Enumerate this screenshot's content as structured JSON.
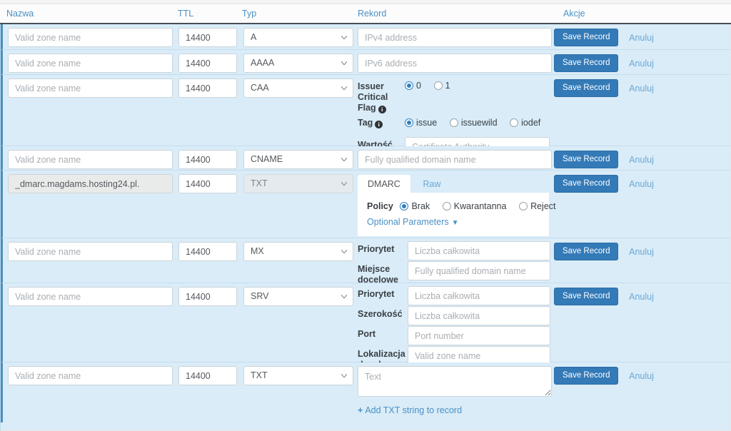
{
  "table": {
    "headers": {
      "name": "Nazwa",
      "ttl": "TTL",
      "type": "Typ",
      "record": "Rekord",
      "actions": "Akcje"
    },
    "common": {
      "name_placeholder": "Valid zone name",
      "ttl_value": "14400",
      "save_label": "Save Record",
      "cancel_label": "Anuluj"
    },
    "rows": [
      {
        "id": "a-record",
        "type_value": "A",
        "name_placeholder": "Valid zone name",
        "name_value": "",
        "ttl_value": "14400",
        "record_placeholder": "IPv4 address"
      },
      {
        "id": "aaaa-record",
        "type_value": "AAAA",
        "name_placeholder": "Valid zone name",
        "name_value": "",
        "ttl_value": "14400",
        "record_placeholder": "IPv6 address"
      },
      {
        "id": "caa-record",
        "type_value": "CAA",
        "name_placeholder": "Valid zone name",
        "name_value": "",
        "ttl_value": "14400",
        "issuer_flag_label": "Issuer Critical Flag",
        "issuer_flag_options": [
          "0",
          "1"
        ],
        "issuer_flag_selected": "0",
        "tag_label": "Tag",
        "tag_options": [
          "issue",
          "issuewild",
          "iodef"
        ],
        "tag_selected": "issue",
        "value_label": "Wartość",
        "value_placeholder": "Certificate Authority"
      },
      {
        "id": "cname-record",
        "type_value": "CNAME",
        "name_placeholder": "Valid zone name",
        "name_value": "",
        "ttl_value": "14400",
        "record_placeholder": "Fully qualified domain name"
      },
      {
        "id": "dmarc-record",
        "type_value": "TXT",
        "name_value": "_dmarc.magdams.hosting24.pl.",
        "name_disabled": true,
        "type_disabled": true,
        "ttl_value": "14400",
        "tabs": [
          {
            "label": "DMARC",
            "active": true
          },
          {
            "label": "Raw",
            "active": false
          }
        ],
        "policy_label": "Policy",
        "policy_options": [
          "Brak",
          "Kwarantanna",
          "Reject"
        ],
        "policy_selected": "Brak",
        "optional_params_label": "Optional Parameters"
      },
      {
        "id": "mx-record",
        "type_value": "MX",
        "name_placeholder": "Valid zone name",
        "name_value": "",
        "ttl_value": "14400",
        "fields": [
          {
            "label": "Priorytet",
            "placeholder": "Liczba całkowita"
          },
          {
            "label": "Miejsce docelowe",
            "placeholder": "Fully qualified domain name"
          }
        ]
      },
      {
        "id": "srv-record",
        "type_value": "SRV",
        "name_placeholder": "Valid zone name",
        "name_value": "",
        "ttl_value": "14400",
        "fields": [
          {
            "label": "Priorytet",
            "placeholder": "Liczba całkowita"
          },
          {
            "label": "Szerokość",
            "placeholder": "Liczba całkowita"
          },
          {
            "label": "Port",
            "placeholder": "Port number"
          },
          {
            "label": "Lokalizacja docelowa",
            "placeholder": "Valid zone name"
          }
        ]
      },
      {
        "id": "txt-record",
        "type_value": "TXT",
        "name_placeholder": "Valid zone name",
        "name_value": "",
        "ttl_value": "14400",
        "textarea_placeholder": "Text",
        "add_string_label": "Add TXT string to record"
      }
    ]
  },
  "icons": {
    "info": "i",
    "chevron_down": "chevron-down-icon",
    "plus": "+",
    "caret_down": "▼"
  },
  "colors": {
    "row_background": "#d9ecf8",
    "row_accent": "#4a8fbd",
    "primary_button": "#337ab7",
    "link": "#4a90c4",
    "muted_link": "#6da7d4",
    "header_text": "#4a90c4"
  }
}
